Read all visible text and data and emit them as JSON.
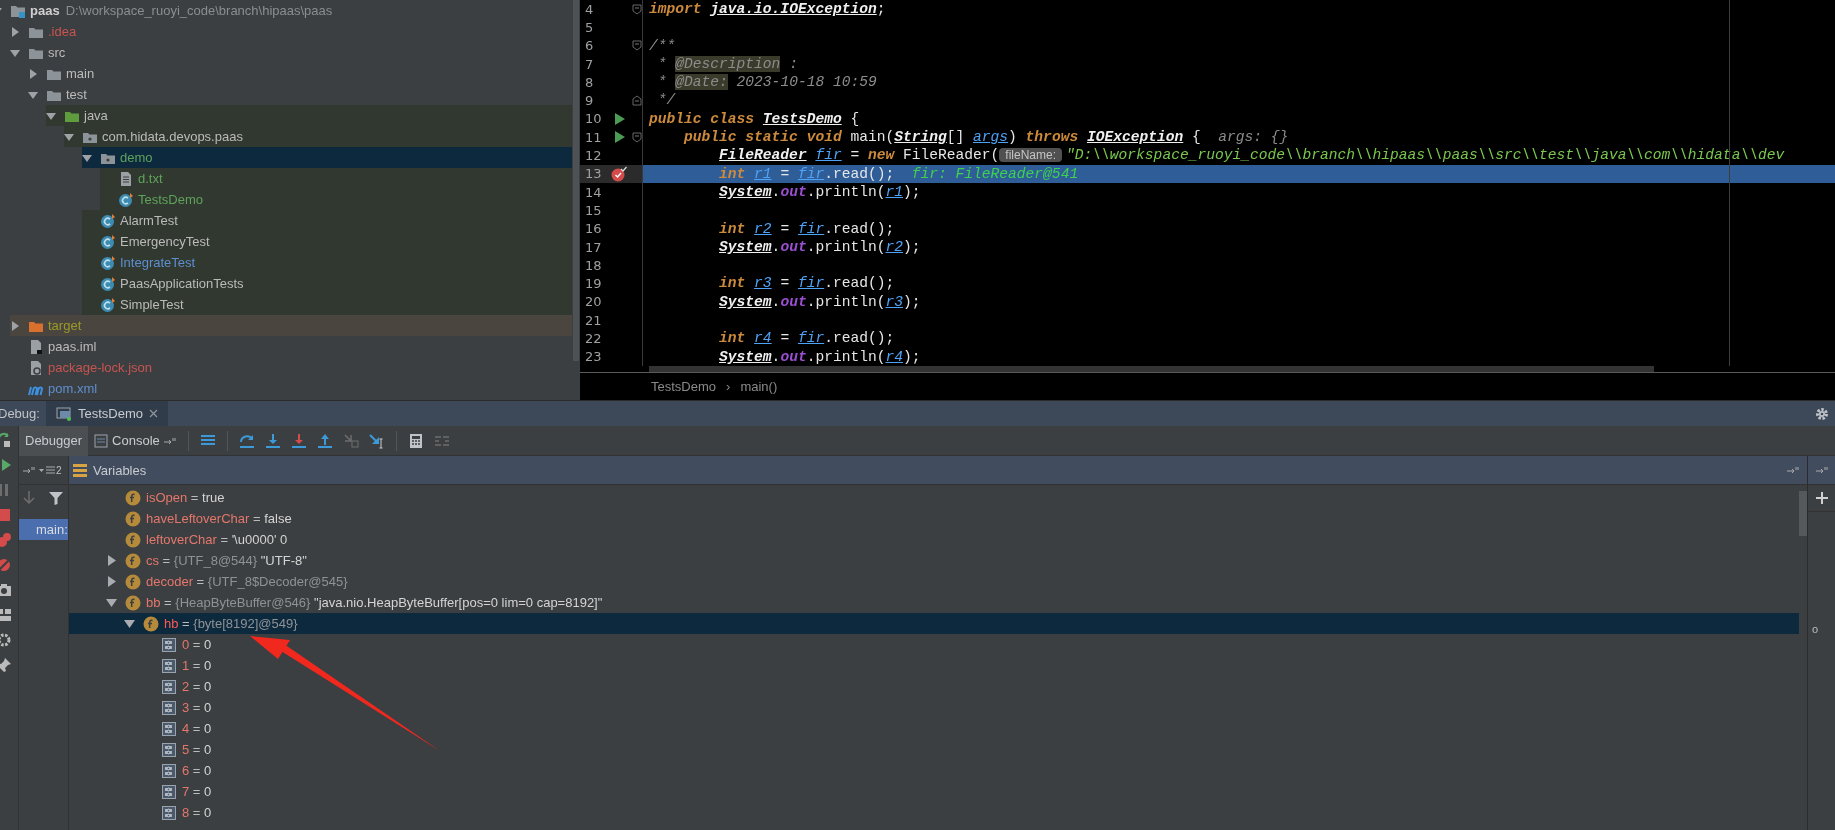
{
  "project_tree": [
    {
      "label": "paas",
      "path": "D:\\workspace_ruoyi_code\\branch\\hipaas\\paas",
      "kind": "module",
      "color": "#d0d0d0",
      "expanded": true,
      "selected": false,
      "test_scope": false,
      "excluded": false,
      "children": [
        {
          "label": ".idea",
          "kind": "folder",
          "color": "#c75450",
          "expanded": false,
          "selected": false,
          "test_scope": false,
          "excluded": false
        },
        {
          "label": "src",
          "kind": "folder",
          "color": "#bbbbbb",
          "expanded": true,
          "selected": false,
          "test_scope": false,
          "excluded": false,
          "children": [
            {
              "label": "main",
              "kind": "folder",
              "color": "#bbbbbb",
              "expanded": false,
              "selected": false,
              "test_scope": false,
              "excluded": false
            },
            {
              "label": "test",
              "kind": "folder",
              "color": "#bbbbbb",
              "expanded": true,
              "selected": false,
              "test_scope": false,
              "excluded": false,
              "children": [
                {
                  "label": "java",
                  "kind": "source_folder",
                  "color": "#bbbbbb",
                  "expanded": true,
                  "selected": false,
                  "test_scope": true,
                  "excluded": false,
                  "children": [
                    {
                      "label": "com.hidata.devops.paas",
                      "kind": "package",
                      "color": "#bbbbbb",
                      "expanded": true,
                      "selected": false,
                      "test_scope": true,
                      "excluded": false,
                      "children": [
                        {
                          "label": "demo",
                          "kind": "package",
                          "color": "#5ea35a",
                          "expanded": true,
                          "selected": true,
                          "test_scope": true,
                          "excluded": false,
                          "children": [
                            {
                              "label": "d.txt",
                              "kind": "text_file",
                              "color": "#5ea35a",
                              "selected": false,
                              "test_scope": true,
                              "excluded": false
                            },
                            {
                              "label": "TestsDemo",
                              "kind": "class",
                              "color": "#5ea35a",
                              "selected": false,
                              "test_scope": true,
                              "excluded": false
                            }
                          ]
                        },
                        {
                          "label": "AlarmTest",
                          "kind": "class",
                          "color": "#bbbbbb",
                          "selected": false,
                          "test_scope": true,
                          "excluded": false
                        },
                        {
                          "label": "EmergencyTest",
                          "kind": "class",
                          "color": "#bbbbbb",
                          "selected": false,
                          "test_scope": true,
                          "excluded": false
                        },
                        {
                          "label": "IntegrateTest",
                          "kind": "class",
                          "color": "#5d8fcf",
                          "selected": false,
                          "test_scope": true,
                          "excluded": false
                        },
                        {
                          "label": "PaasApplicationTests",
                          "kind": "class",
                          "color": "#bbbbbb",
                          "selected": false,
                          "test_scope": true,
                          "excluded": false
                        },
                        {
                          "label": "SimpleTest",
                          "kind": "class",
                          "color": "#bbbbbb",
                          "selected": false,
                          "test_scope": true,
                          "excluded": false
                        }
                      ]
                    }
                  ]
                }
              ]
            }
          ]
        },
        {
          "label": "target",
          "kind": "excluded_folder",
          "color": "#9a9a2a",
          "expanded": false,
          "selected": false,
          "test_scope": false,
          "excluded": true
        },
        {
          "label": "paas.iml",
          "kind": "iml_file",
          "color": "#bbbbbb",
          "selected": false,
          "test_scope": false,
          "excluded": false
        },
        {
          "label": "package-lock.json",
          "kind": "json_file",
          "color": "#c75450",
          "selected": false,
          "test_scope": false,
          "excluded": false
        },
        {
          "label": "pom.xml",
          "kind": "maven_file",
          "color": "#5d8fcf",
          "selected": false,
          "test_scope": false,
          "excluded": false
        }
      ]
    }
  ],
  "editor": {
    "lines": [
      {
        "number": "4",
        "run": false,
        "breakpoint": false,
        "fold_open": true,
        "fold_close": false,
        "current": false,
        "tokens": [
          {
            "text": "import ",
            "kind": "kw"
          },
          {
            "text": "java.io.IOException",
            "kind": "type"
          },
          {
            "text": ";",
            "kind": "plain"
          }
        ]
      },
      {
        "number": "5",
        "run": false,
        "breakpoint": false,
        "fold_open": false,
        "fold_close": false,
        "current": false
      },
      {
        "number": "6",
        "run": false,
        "breakpoint": false,
        "fold_open": true,
        "fold_close": false,
        "current": false,
        "tokens": [
          {
            "text": "/**",
            "kind": "comment"
          }
        ]
      },
      {
        "number": "7",
        "run": false,
        "breakpoint": false,
        "fold_open": false,
        "fold_close": false,
        "current": false,
        "tokens": [
          {
            "text": " * ",
            "kind": "comment"
          },
          {
            "text": "@Description",
            "kind": "doctag"
          },
          {
            "text": " :",
            "kind": "comment"
          }
        ]
      },
      {
        "number": "8",
        "run": false,
        "breakpoint": false,
        "fold_open": false,
        "fold_close": false,
        "current": false,
        "tokens": [
          {
            "text": " * ",
            "kind": "comment"
          },
          {
            "text": "@Date:",
            "kind": "doctag"
          },
          {
            "text": " 2023-10-18 10:59",
            "kind": "comment"
          }
        ]
      },
      {
        "number": "9",
        "run": false,
        "breakpoint": false,
        "fold_open": false,
        "fold_close": true,
        "current": false,
        "tokens": [
          {
            "text": " */",
            "kind": "comment"
          }
        ]
      },
      {
        "number": "10",
        "run": true,
        "breakpoint": false,
        "fold_open": false,
        "fold_close": false,
        "current": false,
        "tokens": [
          {
            "text": "public class ",
            "kind": "kw"
          },
          {
            "text": "TestsDemo",
            "kind": "type"
          },
          {
            "text": " {",
            "kind": "plain"
          }
        ]
      },
      {
        "number": "11",
        "run": true,
        "breakpoint": false,
        "fold_open": true,
        "fold_close": false,
        "current": false,
        "tokens": [
          {
            "text": "    public static void",
            "kind": "kw"
          },
          {
            "text": " main(",
            "kind": "plain"
          },
          {
            "text": "String",
            "kind": "type"
          },
          {
            "text": "[] ",
            "kind": "plain"
          },
          {
            "text": "args",
            "kind": "var"
          },
          {
            "text": ") ",
            "kind": "plain"
          },
          {
            "text": "throws ",
            "kind": "kw"
          },
          {
            "text": "IOException",
            "kind": "type"
          },
          {
            "text": " {",
            "kind": "plain"
          },
          {
            "text": "  args: {}",
            "kind": "hint"
          }
        ]
      },
      {
        "number": "12",
        "run": false,
        "breakpoint": false,
        "fold_open": false,
        "fold_close": false,
        "current": false,
        "tokens": [
          {
            "text": "        FileReader",
            "kind": "type"
          },
          {
            "text": " fir",
            "kind": "var"
          },
          {
            "text": " = ",
            "kind": "plain"
          },
          {
            "text": "new",
            "kind": "kw"
          },
          {
            "text": " FileReader(",
            "kind": "plain"
          },
          {
            "text": "fileName:",
            "kind": "param_hint"
          },
          {
            "text": "\"D:\\\\workspace_ruoyi_code\\\\branch\\\\hipaas\\\\paas\\\\src\\\\test\\\\java\\\\com\\\\hidata\\\\dev",
            "kind": "str"
          }
        ]
      },
      {
        "number": "13",
        "run": false,
        "breakpoint": true,
        "fold_open": false,
        "fold_close": false,
        "current": true,
        "tokens": [
          {
            "text": "        int ",
            "kind": "kw"
          },
          {
            "text": "r1",
            "kind": "var"
          },
          {
            "text": " = ",
            "kind": "plain"
          },
          {
            "text": "fir",
            "kind": "var"
          },
          {
            "text": ".read();",
            "kind": "plain"
          },
          {
            "text": "  fir: FileReader@541",
            "kind": "debug"
          }
        ]
      },
      {
        "number": "14",
        "run": false,
        "breakpoint": false,
        "fold_open": false,
        "fold_close": false,
        "current": false,
        "tokens": [
          {
            "text": "        System",
            "kind": "type"
          },
          {
            "text": ".",
            "kind": "plain"
          },
          {
            "text": "out",
            "kind": "field"
          },
          {
            "text": ".println(",
            "kind": "plain"
          },
          {
            "text": "r1",
            "kind": "var"
          },
          {
            "text": ");",
            "kind": "plain"
          }
        ]
      },
      {
        "number": "15",
        "run": false,
        "breakpoint": false,
        "fold_open": false,
        "fold_close": false,
        "current": false
      },
      {
        "number": "16",
        "run": false,
        "breakpoint": false,
        "fold_open": false,
        "fold_close": false,
        "current": false,
        "tokens": [
          {
            "text": "        int ",
            "kind": "kw"
          },
          {
            "text": "r2",
            "kind": "var"
          },
          {
            "text": " = ",
            "kind": "plain"
          },
          {
            "text": "fir",
            "kind": "var"
          },
          {
            "text": ".read();",
            "kind": "plain"
          }
        ]
      },
      {
        "number": "17",
        "run": false,
        "breakpoint": false,
        "fold_open": false,
        "fold_close": false,
        "current": false,
        "tokens": [
          {
            "text": "        System",
            "kind": "type"
          },
          {
            "text": ".",
            "kind": "plain"
          },
          {
            "text": "out",
            "kind": "field"
          },
          {
            "text": ".println(",
            "kind": "plain"
          },
          {
            "text": "r2",
            "kind": "var"
          },
          {
            "text": ");",
            "kind": "plain"
          }
        ]
      },
      {
        "number": "18",
        "run": false,
        "breakpoint": false,
        "fold_open": false,
        "fold_close": false,
        "current": false
      },
      {
        "number": "19",
        "run": false,
        "breakpoint": false,
        "fold_open": false,
        "fold_close": false,
        "current": false,
        "tokens": [
          {
            "text": "        int ",
            "kind": "kw"
          },
          {
            "text": "r3",
            "kind": "var"
          },
          {
            "text": " = ",
            "kind": "plain"
          },
          {
            "text": "fir",
            "kind": "var"
          },
          {
            "text": ".read();",
            "kind": "plain"
          }
        ]
      },
      {
        "number": "20",
        "run": false,
        "breakpoint": false,
        "fold_open": false,
        "fold_close": false,
        "current": false,
        "tokens": [
          {
            "text": "        System",
            "kind": "type"
          },
          {
            "text": ".",
            "kind": "plain"
          },
          {
            "text": "out",
            "kind": "field"
          },
          {
            "text": ".println(",
            "kind": "plain"
          },
          {
            "text": "r3",
            "kind": "var"
          },
          {
            "text": ");",
            "kind": "plain"
          }
        ]
      },
      {
        "number": "21",
        "run": false,
        "breakpoint": false,
        "fold_open": false,
        "fold_close": false,
        "current": false
      },
      {
        "number": "22",
        "run": false,
        "breakpoint": false,
        "fold_open": false,
        "fold_close": false,
        "current": false,
        "tokens": [
          {
            "text": "        int ",
            "kind": "kw"
          },
          {
            "text": "r4",
            "kind": "var"
          },
          {
            "text": " = ",
            "kind": "plain"
          },
          {
            "text": "fir",
            "kind": "var"
          },
          {
            "text": ".read();",
            "kind": "plain"
          }
        ]
      },
      {
        "number": "23",
        "run": false,
        "breakpoint": false,
        "fold_open": false,
        "fold_close": false,
        "current": false,
        "tokens": [
          {
            "text": "        System",
            "kind": "type"
          },
          {
            "text": ".",
            "kind": "plain"
          },
          {
            "text": "out",
            "kind": "field"
          },
          {
            "text": ".println(",
            "kind": "plain"
          },
          {
            "text": "r4",
            "kind": "var"
          },
          {
            "text": ");",
            "kind": "plain"
          }
        ]
      }
    ],
    "breadcrumb": {
      "items": [
        "TestsDemo",
        "main()"
      ],
      "separator": "›"
    }
  },
  "debug": {
    "label": "Debug:",
    "tabs": [
      {
        "label": "TestsDemo",
        "selected": true
      }
    ],
    "subtabs": [
      {
        "label": "Debugger",
        "selected": true
      },
      {
        "label": "Console",
        "selected": false
      }
    ],
    "frames_badge": "2",
    "variables_title": "Variables",
    "frames": [
      {
        "label": "main:",
        "selected": true
      }
    ],
    "variables": [
      {
        "name": "isOpen",
        "op": "=",
        "value": "true",
        "kind": "field",
        "selected": false
      },
      {
        "name": "haveLeftoverChar",
        "op": "=",
        "value": "false",
        "kind": "field",
        "selected": false
      },
      {
        "name": "leftoverChar",
        "op": "=",
        "value": "'\\u0000' 0",
        "kind": "field",
        "selected": false
      },
      {
        "name": "cs",
        "op": "=",
        "ref": "{UTF_8@544}",
        "value": "\"UTF-8\"",
        "kind": "field",
        "expanded": false,
        "selected": false
      },
      {
        "name": "decoder",
        "op": "=",
        "ref": "{UTF_8$Decoder@545}",
        "kind": "field",
        "expanded": false,
        "selected": false
      },
      {
        "name": "bb",
        "op": "=",
        "ref": "{HeapByteBuffer@546}",
        "value": "\"java.nio.HeapByteBuffer[pos=0 lim=0 cap=8192]\"",
        "kind": "field",
        "expanded": true,
        "selected": false,
        "children": [
          {
            "name": "hb",
            "op": "=",
            "ref": "{byte[8192]@549}",
            "kind": "field",
            "expanded": true,
            "selected": true,
            "children": [
              {
                "name": "0",
                "op": "=",
                "value": "0",
                "kind": "element",
                "selected": false
              },
              {
                "name": "1",
                "op": "=",
                "value": "0",
                "kind": "element",
                "selected": false
              },
              {
                "name": "2",
                "op": "=",
                "value": "0",
                "kind": "element",
                "selected": false
              },
              {
                "name": "3",
                "op": "=",
                "value": "0",
                "kind": "element",
                "selected": false
              },
              {
                "name": "4",
                "op": "=",
                "value": "0",
                "kind": "element",
                "selected": false
              },
              {
                "name": "5",
                "op": "=",
                "value": "0",
                "kind": "element",
                "selected": false
              },
              {
                "name": "6",
                "op": "=",
                "value": "0",
                "kind": "element",
                "selected": false
              },
              {
                "name": "7",
                "op": "=",
                "value": "0",
                "kind": "element",
                "selected": false
              },
              {
                "name": "8",
                "op": "=",
                "value": "0",
                "kind": "element",
                "selected": false
              }
            ]
          }
        ]
      }
    ],
    "watches_text": "o"
  }
}
